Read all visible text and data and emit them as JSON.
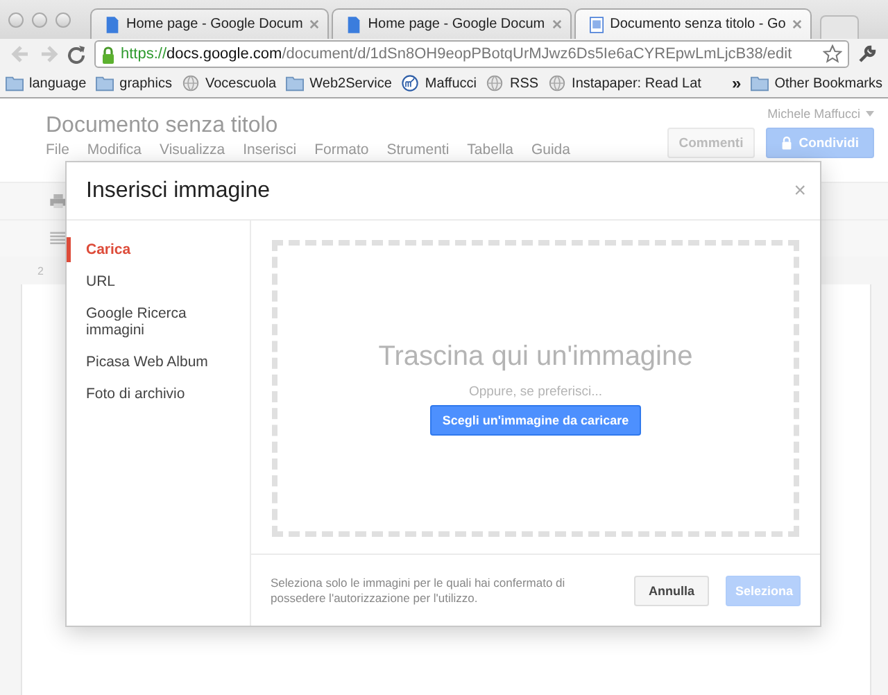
{
  "browser": {
    "tabs": [
      {
        "title": "Home page - Google Docum",
        "kind": "doc",
        "selected": false
      },
      {
        "title": "Home page - Google Docum",
        "kind": "doc",
        "selected": false
      },
      {
        "title": "Documento senza titolo - Go",
        "kind": "page",
        "selected": true
      }
    ],
    "url": {
      "scheme": "https://",
      "host": "docs.google.com",
      "path": "/document/d/1dSn8OH9eopPBotqUrMJwz6Ds5Ie6aCYREpwLmLjcB38/edit"
    },
    "bookmarks": [
      {
        "label": "language",
        "kind": "folder"
      },
      {
        "label": "graphics",
        "kind": "folder"
      },
      {
        "label": "Vocescuola",
        "kind": "globe"
      },
      {
        "label": "Web2Service",
        "kind": "folder"
      },
      {
        "label": "Maffucci",
        "kind": "logo"
      },
      {
        "label": "RSS",
        "kind": "globe"
      },
      {
        "label": "Instapaper: Read Lat",
        "kind": "globe"
      }
    ],
    "overflow": "»",
    "other_bookmarks": "Other Bookmarks"
  },
  "document": {
    "user": "Michele Maffucci",
    "title": "Documento senza titolo",
    "menu": [
      "File",
      "Modifica",
      "Visualizza",
      "Inserisci",
      "Formato",
      "Strumenti",
      "Tabella",
      "Guida"
    ],
    "comments_button": "Commenti",
    "share_button": "Condividi",
    "ruler_number": "2"
  },
  "dialog": {
    "title": "Inserisci immagine",
    "close": "×",
    "sources": [
      {
        "label": "Carica",
        "selected": true
      },
      {
        "label": "URL",
        "selected": false
      },
      {
        "label": "Google Ricerca immagini",
        "selected": false
      },
      {
        "label": "Picasa Web Album",
        "selected": false
      },
      {
        "label": "Foto di archivio",
        "selected": false
      }
    ],
    "drop_heading": "Trascina qui un'immagine",
    "alternative": "Oppure, se preferisci...",
    "upload_button": "Scegli un'immagine da caricare",
    "notice": "Seleziona solo le immagini per le quali hai confermato di possedere l'autorizzazione per l'utilizzo.",
    "cancel_button": "Annulla",
    "select_button": {
      "label": "Seleziona",
      "disabled": true
    }
  }
}
